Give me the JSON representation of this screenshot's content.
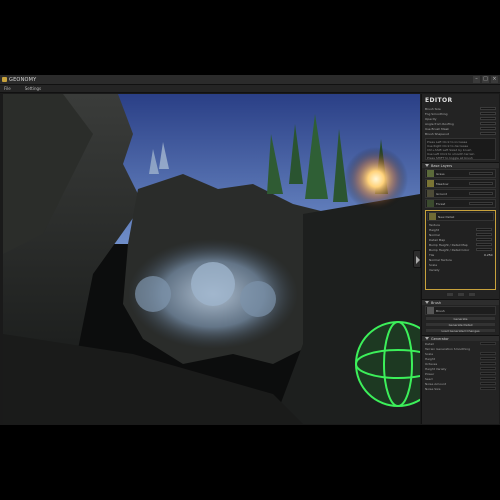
{
  "window": {
    "title": "GEONOMY"
  },
  "menubar": {
    "items": [
      "File",
      "Settings"
    ]
  },
  "panel": {
    "header": "EDITOR",
    "top_rows": [
      "Brush Size",
      "Fog Smoothing",
      "Opacity",
      "Angle from Roofing",
      "Use Brush Mask",
      "Brush Shapeout"
    ],
    "note_lines": [
      "Press Left Click to increase",
      "Use Right Click to decrease",
      "Ctrl+Shift Left Sized by brush",
      "Use Left Click to smooth terrain",
      "Press SHIFT to toggle all brush"
    ],
    "sections": {
      "base_layers": "Base Layers",
      "brush": "Brush",
      "generator": "Generator"
    },
    "base_layers": [
      "Grass",
      "Meadow",
      "Ground",
      "Forest"
    ],
    "active_layer": {
      "name": "New Detail",
      "rows": [
        "Texture",
        "Height",
        "Normal",
        "Detail Map",
        "Bump Height / Detail Map",
        "Bump Height / Detail Color",
        "Tile",
        "Normal Texture",
        "Scale",
        "Variety"
      ],
      "tile_value": "0.250"
    },
    "brush_layer": "Brush",
    "buttons": [
      "Generate",
      "Generate Detail",
      "Load Generated Changes"
    ],
    "generator_rows": [
      "Detail",
      "Terrain Generation Smoothing",
      "Scale",
      "Height",
      "Octaves",
      "Height Variety",
      "Power",
      "Seed",
      "Noise Amount",
      "Noise Size"
    ]
  },
  "colors": {
    "accent": "#c8a23c",
    "gizmo": "#3cf05a"
  },
  "icons": {
    "logo": "app-logo-icon",
    "minimize": "minimize-icon",
    "maximize": "maximize-icon",
    "close": "close-icon",
    "collapse": "collapse-arrow-icon"
  }
}
